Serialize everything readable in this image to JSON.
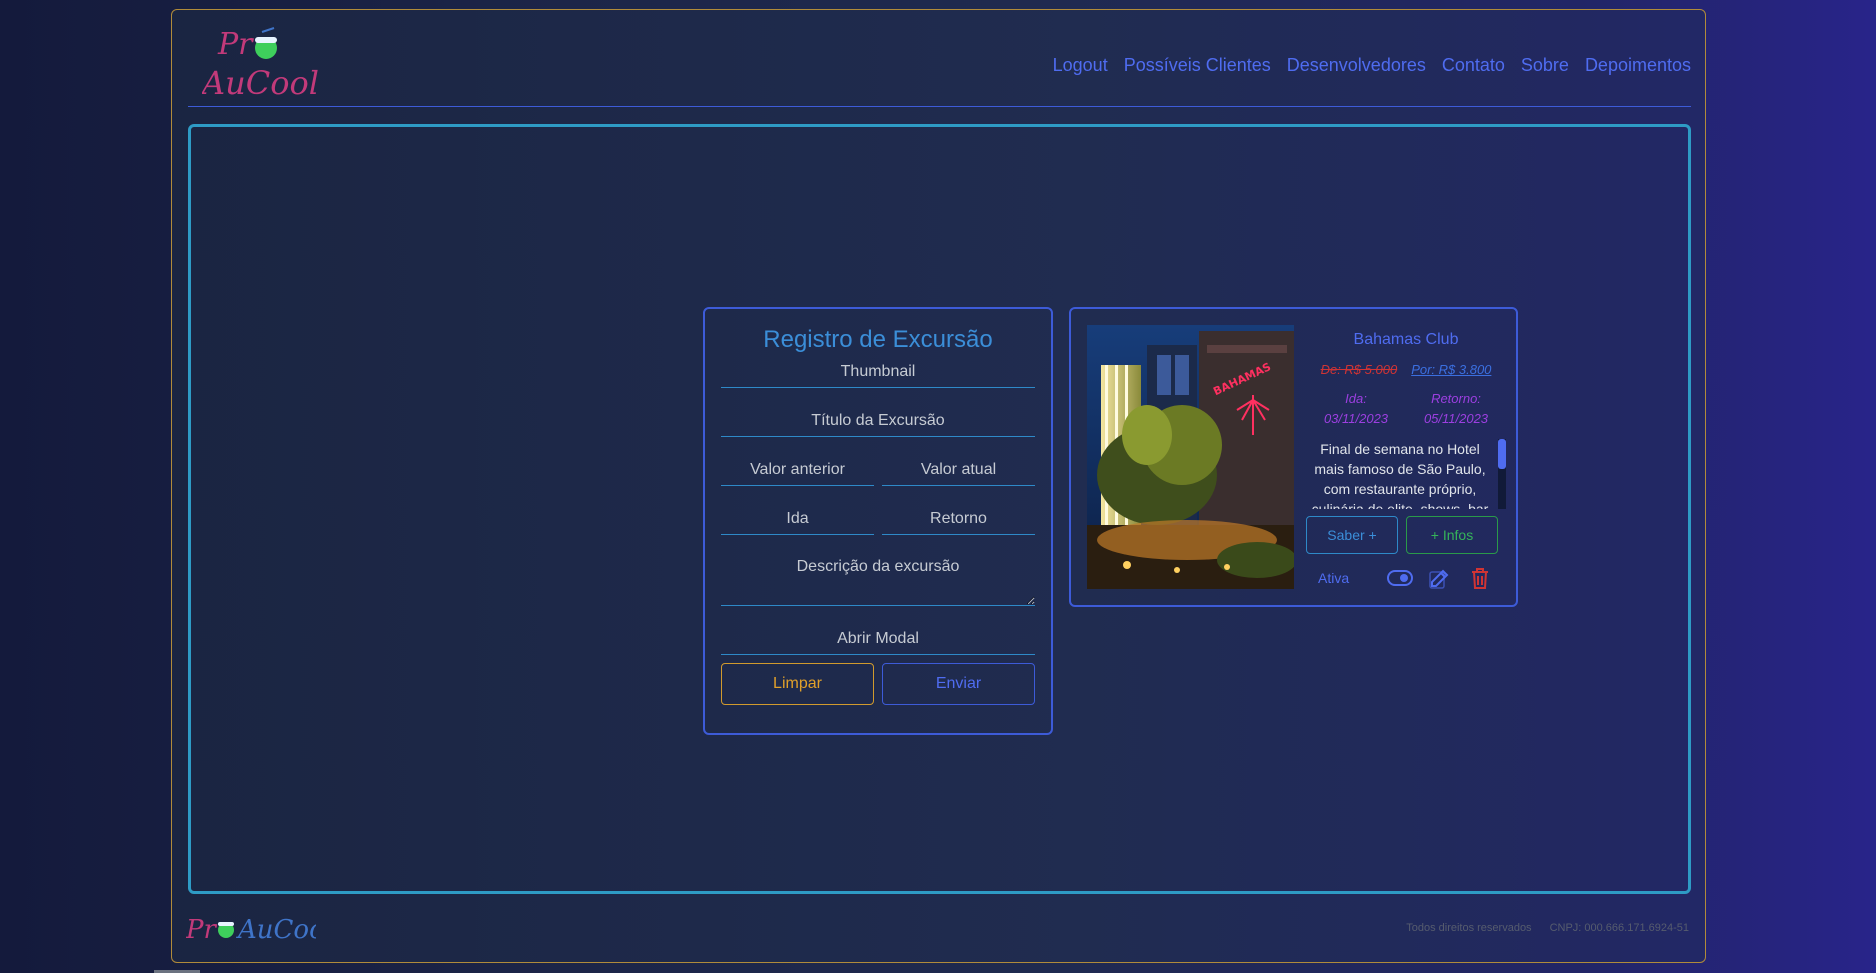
{
  "brand": {
    "logo_line1": "Pr",
    "logo_line2": "AuCool",
    "colors": {
      "accent_blue": "#4f6cf0",
      "cyan": "#2e9bc5",
      "gold": "#b08b3a",
      "logo_pink": "#c23a7a",
      "logo_blue": "#3f74c8",
      "logo_green": "#3ecf5c"
    }
  },
  "nav": [
    {
      "label": "Logout"
    },
    {
      "label": "Possíveis Clientes"
    },
    {
      "label": "Desenvolvedores"
    },
    {
      "label": "Contato"
    },
    {
      "label": "Sobre"
    },
    {
      "label": "Depoimentos"
    }
  ],
  "form": {
    "title": "Registro de Excursão",
    "thumbnail_placeholder": "Thumbnail",
    "title_placeholder": "Título da Excursão",
    "old_value_placeholder": "Valor anterior",
    "new_value_placeholder": "Valor atual",
    "departure_placeholder": "Ida",
    "return_placeholder": "Retorno",
    "description_placeholder": "Descrição da excursão",
    "modal_placeholder": "Abrir Modal",
    "clear_label": "Limpar",
    "send_label": "Enviar"
  },
  "excursion": {
    "title": "Bahamas Club",
    "old_price": "De: R$ 5.000",
    "new_price": "Por: R$ 3.800",
    "departure_label": "Ida:",
    "departure_date": "03/11/2023",
    "return_label": "Retorno:",
    "return_date": "05/11/2023",
    "description": "Final de semana no Hotel mais famoso de São Paulo, com restaurante próprio, culinária de elite, shows, bar",
    "more_label": "Saber +",
    "info_label": "+ Infos",
    "status": "Ativa",
    "icons": [
      "toggle-icon",
      "edit-icon",
      "trash-icon"
    ],
    "sign_text": "BAHAMAS"
  },
  "footer": {
    "rights": "Todos direitos reservados",
    "cnpj": "CNPJ: 000.666.171.6924-51"
  }
}
